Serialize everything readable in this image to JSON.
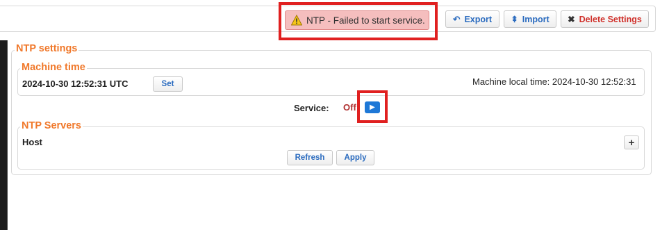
{
  "toolbar": {
    "alert_text": "NTP - Failed to start service.",
    "export_label": "Export",
    "import_label": "Import",
    "delete_label": "Delete Settings"
  },
  "ntp_settings": {
    "title": "NTP settings",
    "machine_time": {
      "title": "Machine time",
      "utc_value": "2024-10-30 12:52:31 UTC",
      "set_label": "Set",
      "local_time_label": "Machine local time: 2024-10-30 12:52:31"
    },
    "service": {
      "label": "Service:",
      "status": "Off"
    },
    "ntp_servers": {
      "title": "NTP Servers",
      "column_header": "Host",
      "refresh_label": "Refresh",
      "apply_label": "Apply"
    }
  },
  "colors": {
    "accent": "#f0782a",
    "link": "#2a6bbf",
    "alert_bg": "#f5bebe",
    "highlight": "#e02020",
    "status_off": "#b03030",
    "play": "#1e78d7"
  }
}
